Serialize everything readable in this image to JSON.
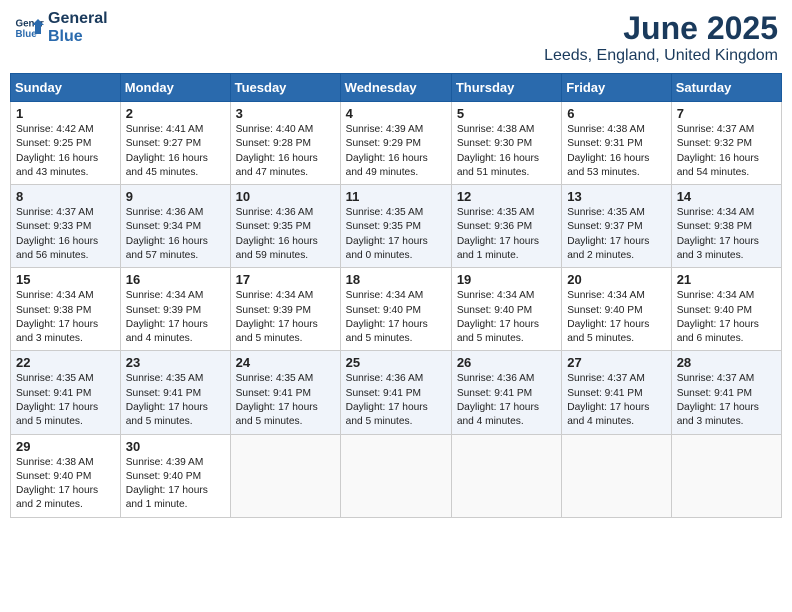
{
  "header": {
    "logo_line1": "General",
    "logo_line2": "Blue",
    "month_title": "June 2025",
    "location": "Leeds, England, United Kingdom"
  },
  "weekdays": [
    "Sunday",
    "Monday",
    "Tuesday",
    "Wednesday",
    "Thursday",
    "Friday",
    "Saturday"
  ],
  "weeks": [
    [
      {
        "day": "1",
        "info": "Sunrise: 4:42 AM\nSunset: 9:25 PM\nDaylight: 16 hours\nand 43 minutes."
      },
      {
        "day": "2",
        "info": "Sunrise: 4:41 AM\nSunset: 9:27 PM\nDaylight: 16 hours\nand 45 minutes."
      },
      {
        "day": "3",
        "info": "Sunrise: 4:40 AM\nSunset: 9:28 PM\nDaylight: 16 hours\nand 47 minutes."
      },
      {
        "day": "4",
        "info": "Sunrise: 4:39 AM\nSunset: 9:29 PM\nDaylight: 16 hours\nand 49 minutes."
      },
      {
        "day": "5",
        "info": "Sunrise: 4:38 AM\nSunset: 9:30 PM\nDaylight: 16 hours\nand 51 minutes."
      },
      {
        "day": "6",
        "info": "Sunrise: 4:38 AM\nSunset: 9:31 PM\nDaylight: 16 hours\nand 53 minutes."
      },
      {
        "day": "7",
        "info": "Sunrise: 4:37 AM\nSunset: 9:32 PM\nDaylight: 16 hours\nand 54 minutes."
      }
    ],
    [
      {
        "day": "8",
        "info": "Sunrise: 4:37 AM\nSunset: 9:33 PM\nDaylight: 16 hours\nand 56 minutes."
      },
      {
        "day": "9",
        "info": "Sunrise: 4:36 AM\nSunset: 9:34 PM\nDaylight: 16 hours\nand 57 minutes."
      },
      {
        "day": "10",
        "info": "Sunrise: 4:36 AM\nSunset: 9:35 PM\nDaylight: 16 hours\nand 59 minutes."
      },
      {
        "day": "11",
        "info": "Sunrise: 4:35 AM\nSunset: 9:35 PM\nDaylight: 17 hours\nand 0 minutes."
      },
      {
        "day": "12",
        "info": "Sunrise: 4:35 AM\nSunset: 9:36 PM\nDaylight: 17 hours\nand 1 minute."
      },
      {
        "day": "13",
        "info": "Sunrise: 4:35 AM\nSunset: 9:37 PM\nDaylight: 17 hours\nand 2 minutes."
      },
      {
        "day": "14",
        "info": "Sunrise: 4:34 AM\nSunset: 9:38 PM\nDaylight: 17 hours\nand 3 minutes."
      }
    ],
    [
      {
        "day": "15",
        "info": "Sunrise: 4:34 AM\nSunset: 9:38 PM\nDaylight: 17 hours\nand 3 minutes."
      },
      {
        "day": "16",
        "info": "Sunrise: 4:34 AM\nSunset: 9:39 PM\nDaylight: 17 hours\nand 4 minutes."
      },
      {
        "day": "17",
        "info": "Sunrise: 4:34 AM\nSunset: 9:39 PM\nDaylight: 17 hours\nand 5 minutes."
      },
      {
        "day": "18",
        "info": "Sunrise: 4:34 AM\nSunset: 9:40 PM\nDaylight: 17 hours\nand 5 minutes."
      },
      {
        "day": "19",
        "info": "Sunrise: 4:34 AM\nSunset: 9:40 PM\nDaylight: 17 hours\nand 5 minutes."
      },
      {
        "day": "20",
        "info": "Sunrise: 4:34 AM\nSunset: 9:40 PM\nDaylight: 17 hours\nand 5 minutes."
      },
      {
        "day": "21",
        "info": "Sunrise: 4:34 AM\nSunset: 9:40 PM\nDaylight: 17 hours\nand 6 minutes."
      }
    ],
    [
      {
        "day": "22",
        "info": "Sunrise: 4:35 AM\nSunset: 9:41 PM\nDaylight: 17 hours\nand 5 minutes."
      },
      {
        "day": "23",
        "info": "Sunrise: 4:35 AM\nSunset: 9:41 PM\nDaylight: 17 hours\nand 5 minutes."
      },
      {
        "day": "24",
        "info": "Sunrise: 4:35 AM\nSunset: 9:41 PM\nDaylight: 17 hours\nand 5 minutes."
      },
      {
        "day": "25",
        "info": "Sunrise: 4:36 AM\nSunset: 9:41 PM\nDaylight: 17 hours\nand 5 minutes."
      },
      {
        "day": "26",
        "info": "Sunrise: 4:36 AM\nSunset: 9:41 PM\nDaylight: 17 hours\nand 4 minutes."
      },
      {
        "day": "27",
        "info": "Sunrise: 4:37 AM\nSunset: 9:41 PM\nDaylight: 17 hours\nand 4 minutes."
      },
      {
        "day": "28",
        "info": "Sunrise: 4:37 AM\nSunset: 9:41 PM\nDaylight: 17 hours\nand 3 minutes."
      }
    ],
    [
      {
        "day": "29",
        "info": "Sunrise: 4:38 AM\nSunset: 9:40 PM\nDaylight: 17 hours\nand 2 minutes."
      },
      {
        "day": "30",
        "info": "Sunrise: 4:39 AM\nSunset: 9:40 PM\nDaylight: 17 hours\nand 1 minute."
      },
      {
        "day": "",
        "info": ""
      },
      {
        "day": "",
        "info": ""
      },
      {
        "day": "",
        "info": ""
      },
      {
        "day": "",
        "info": ""
      },
      {
        "day": "",
        "info": ""
      }
    ]
  ]
}
